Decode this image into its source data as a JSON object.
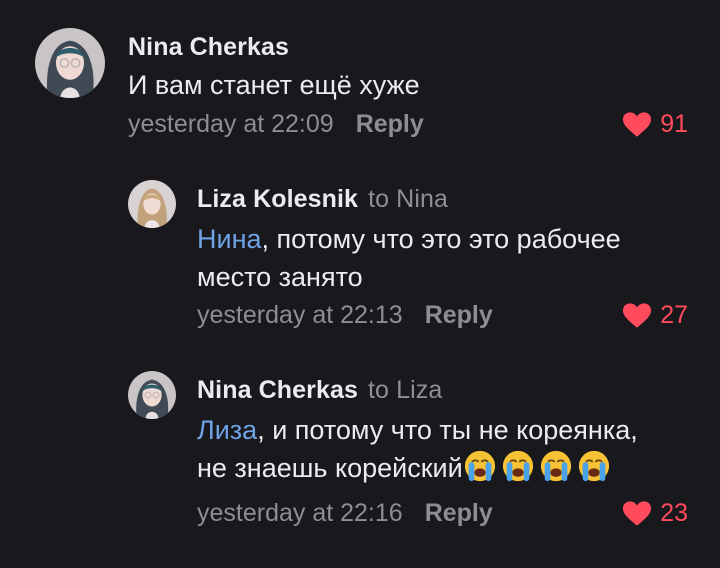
{
  "comments": [
    {
      "author": "Nina Cherkas",
      "reply_to": "",
      "mention": "",
      "text_lines": [
        "И вам станет ещё хуже"
      ],
      "time": "yesterday at 22:09",
      "reply_label": "Reply",
      "likes": "91"
    },
    {
      "author": "Liza Kolesnik",
      "reply_to": "to Nina",
      "mention": "Нина",
      "text_lines": [
        ", потому что это это рабочее",
        "место занято"
      ],
      "time": "yesterday at 22:13",
      "reply_label": "Reply",
      "likes": "27"
    },
    {
      "author": "Nina Cherkas",
      "reply_to": "to Liza",
      "mention": "Лиза",
      "text_lines": [
        ", и потому что ты не кореянка,",
        "не знаешь корейский"
      ],
      "emojis": [
        "crying-face",
        "crying-face",
        "crying-face",
        "crying-face"
      ],
      "time": "yesterday at 22:16",
      "reply_label": "Reply",
      "likes": "23"
    }
  ],
  "colors": {
    "background": "#19181d",
    "text": "#ecebf0",
    "muted": "#8e8d95",
    "mention": "#6fa3e6",
    "like": "#ff4b5c"
  }
}
